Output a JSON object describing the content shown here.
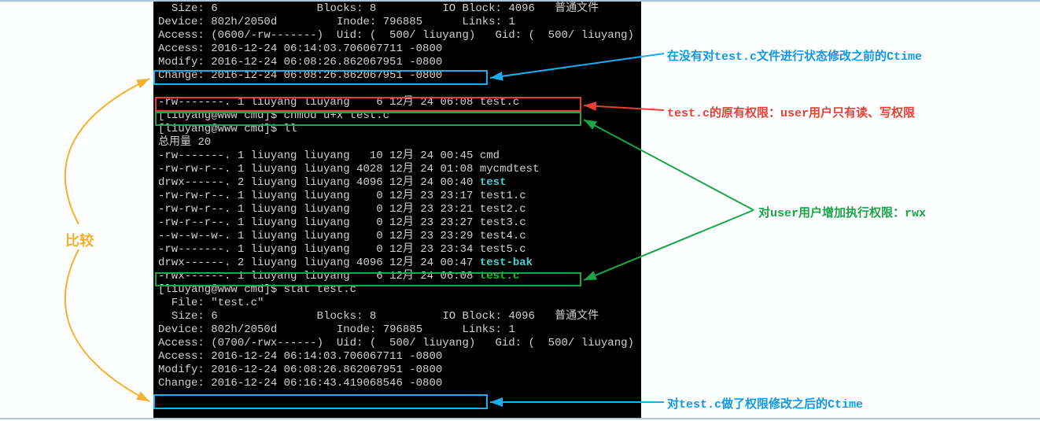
{
  "stat1": {
    "size_label": "Size:",
    "size": "6",
    "blocks_label": "Blocks:",
    "blocks": "8",
    "ioblock_label": "IO Block:",
    "ioblock": "4096",
    "ftype": "普通文件",
    "device_label": "Device:",
    "device": "802h/2050d",
    "inode_label": "Inode:",
    "inode": "796885",
    "links_label": "Links:",
    "links": "1",
    "access_perm": "Access: (0600/-rw-------)  Uid: (  500/ liuyang)   Gid: (  500/ liuyang)",
    "access_time": "Access: 2016-12-24 06:14:03.706067711 -0800",
    "modify_time": "Modify: 2016-12-24 06:08:26.862067951 -0800",
    "change_time": "Change: 2016-12-24 06:08:26.862067951 -0800"
  },
  "ls_before": "-rw-------. 1 liuyang liuyang    6 12月 24 06:08 test.c",
  "prompt_chmod": "[liuyang@www cmd]$ chmod u+x test.c",
  "prompt_ll": "[liuyang@www cmd]$ ll",
  "total": "总用量 20",
  "ll": [
    {
      "perm": "-rw-------.",
      "n": "1",
      "u": "liuyang",
      "g": "liuyang",
      "sz": "  10",
      "date": "12月 24 00:45",
      "name": "cmd",
      "cls": ""
    },
    {
      "perm": "-rw-rw-r--.",
      "n": "1",
      "u": "liuyang",
      "g": "liuyang",
      "sz": "4028",
      "date": "12月 24 01:08",
      "name": "mycmdtest",
      "cls": ""
    },
    {
      "perm": "drwx------.",
      "n": "2",
      "u": "liuyang",
      "g": "liuyang",
      "sz": "4096",
      "date": "12月 24 00:40",
      "name": "test",
      "cls": "cyan"
    },
    {
      "perm": "-rw-rw-r--.",
      "n": "1",
      "u": "liuyang",
      "g": "liuyang",
      "sz": "   0",
      "date": "12月 23 23:17",
      "name": "test1.c",
      "cls": ""
    },
    {
      "perm": "-rw-rw-r--.",
      "n": "1",
      "u": "liuyang",
      "g": "liuyang",
      "sz": "   0",
      "date": "12月 23 23:21",
      "name": "test2.c",
      "cls": ""
    },
    {
      "perm": "-rw-r--r--.",
      "n": "1",
      "u": "liuyang",
      "g": "liuyang",
      "sz": "   0",
      "date": "12月 23 23:27",
      "name": "test3.c",
      "cls": ""
    },
    {
      "perm": "--w--w--w-.",
      "n": "1",
      "u": "liuyang",
      "g": "liuyang",
      "sz": "   0",
      "date": "12月 23 23:29",
      "name": "test4.c",
      "cls": ""
    },
    {
      "perm": "-rw-------.",
      "n": "1",
      "u": "liuyang",
      "g": "liuyang",
      "sz": "   0",
      "date": "12月 23 23:34",
      "name": "test5.c",
      "cls": ""
    },
    {
      "perm": "drwx------.",
      "n": "2",
      "u": "liuyang",
      "g": "liuyang",
      "sz": "4096",
      "date": "12月 24 00:47",
      "name": "test-bak",
      "cls": "cyan"
    },
    {
      "perm": "-rwx------.",
      "n": "1",
      "u": "liuyang",
      "g": "liuyang",
      "sz": "   6",
      "date": "12月 24 06:08",
      "name": "test.c",
      "cls": "green"
    }
  ],
  "prompt_stat": "[liuyang@www cmd]$ stat test.c",
  "stat2": {
    "file_line": "  File: \"test.c\"",
    "size_label": "Size:",
    "size": "6",
    "blocks_label": "Blocks:",
    "blocks": "8",
    "ioblock_label": "IO Block:",
    "ioblock": "4096",
    "ftype": "普通文件",
    "device_label": "Device:",
    "device": "802h/2050d",
    "inode_label": "Inode:",
    "inode": "796885",
    "links_label": "Links:",
    "links": "1",
    "access_perm": "Access: (0700/-rwx------)  Uid: (  500/ liuyang)   Gid: (  500/ liuyang)",
    "access_time": "Access: 2016-12-24 06:14:03.706067711 -0800",
    "modify_time": "Modify: 2016-12-24 06:08:26.862067951 -0800",
    "change_time": "Change: 2016-12-24 06:16:43.419068546 -0800"
  },
  "annotations": {
    "top_blue": "在没有对test.c文件进行状态修改之前的Ctime",
    "red_perm": "test.c的原有权限：user用户只有读、写权限",
    "green_rwx": "对user用户增加执行权限：rwx",
    "bottom_blue": "对test.c做了权限修改之后的Ctime",
    "compare": "比较"
  }
}
